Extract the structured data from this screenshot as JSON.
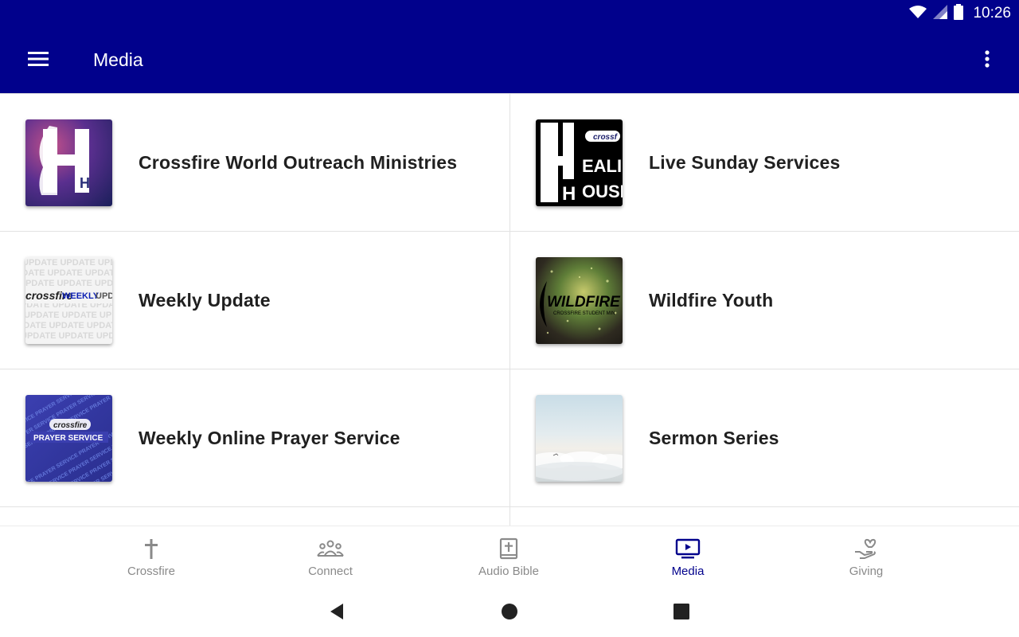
{
  "status_bar": {
    "time": "10:26"
  },
  "app_bar": {
    "title": "Media"
  },
  "colors": {
    "brand": "#01018c",
    "active_nav": "#01018c",
    "inactive_nav": "#8a8a8a"
  },
  "media_items": [
    {
      "label": "Crossfire World Outreach Ministries",
      "thumb_text": "H"
    },
    {
      "label": "Live Sunday Services",
      "thumb_text": "HEALIN HOUSE"
    },
    {
      "label": "Weekly Update",
      "thumb_text": "WEEKLY UPDATE"
    },
    {
      "label": "Wildfire Youth",
      "thumb_text": "WILDFIRE"
    },
    {
      "label": "Weekly Online Prayer Service",
      "thumb_text": "PRAYER SERVICE"
    },
    {
      "label": "Sermon Series",
      "thumb_text": ""
    }
  ],
  "bottom_nav": [
    {
      "label": "Crossfire",
      "icon": "cross-icon",
      "active": false
    },
    {
      "label": "Connect",
      "icon": "people-icon",
      "active": false
    },
    {
      "label": "Audio Bible",
      "icon": "bible-icon",
      "active": false
    },
    {
      "label": "Media",
      "icon": "media-icon",
      "active": true
    },
    {
      "label": "Giving",
      "icon": "giving-icon",
      "active": false
    }
  ]
}
